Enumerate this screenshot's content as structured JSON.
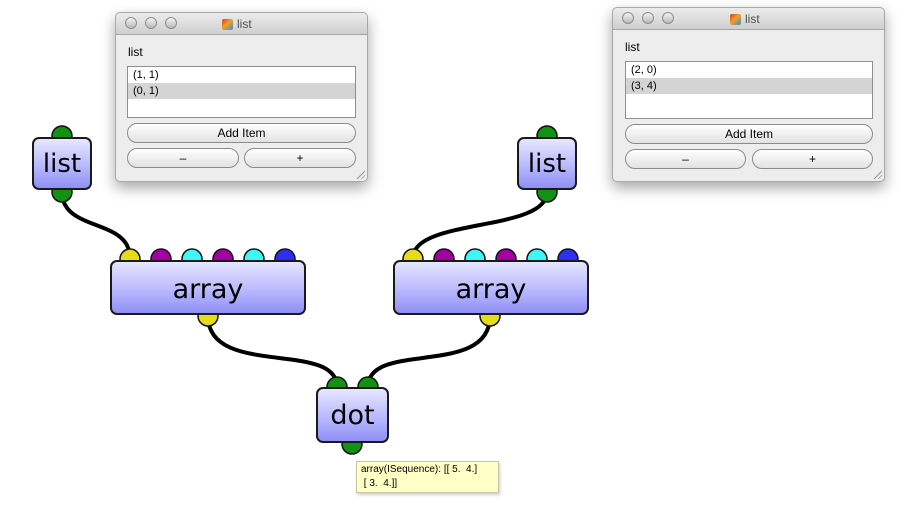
{
  "nodes": {
    "list_left": {
      "label": "list"
    },
    "list_right": {
      "label": "list"
    },
    "array_left": {
      "label": "array"
    },
    "array_right": {
      "label": "array"
    },
    "dot": {
      "label": "dot"
    }
  },
  "port_colors": {
    "data": "#e4dc1a",
    "connector": "#129112",
    "purple": "#a300a3",
    "cyan": "#3ff6f6",
    "blue": "#2f2ff2"
  },
  "windows": {
    "left": {
      "title": "list",
      "label": "list",
      "items": [
        "(1, 1)",
        "(0, 1)"
      ],
      "selected_index": 1,
      "add_label": "Add Item",
      "minus_label": "–",
      "plus_label": "+"
    },
    "right": {
      "title": "list",
      "label": "list",
      "items": [
        "(2, 0)",
        "(3, 4)"
      ],
      "selected_index": 1,
      "add_label": "Add Item",
      "minus_label": "–",
      "plus_label": "+"
    }
  },
  "tooltip": {
    "line1": "array(ISequence): [[ 5.  4.]",
    "line2": " [ 3.  4.]]"
  }
}
